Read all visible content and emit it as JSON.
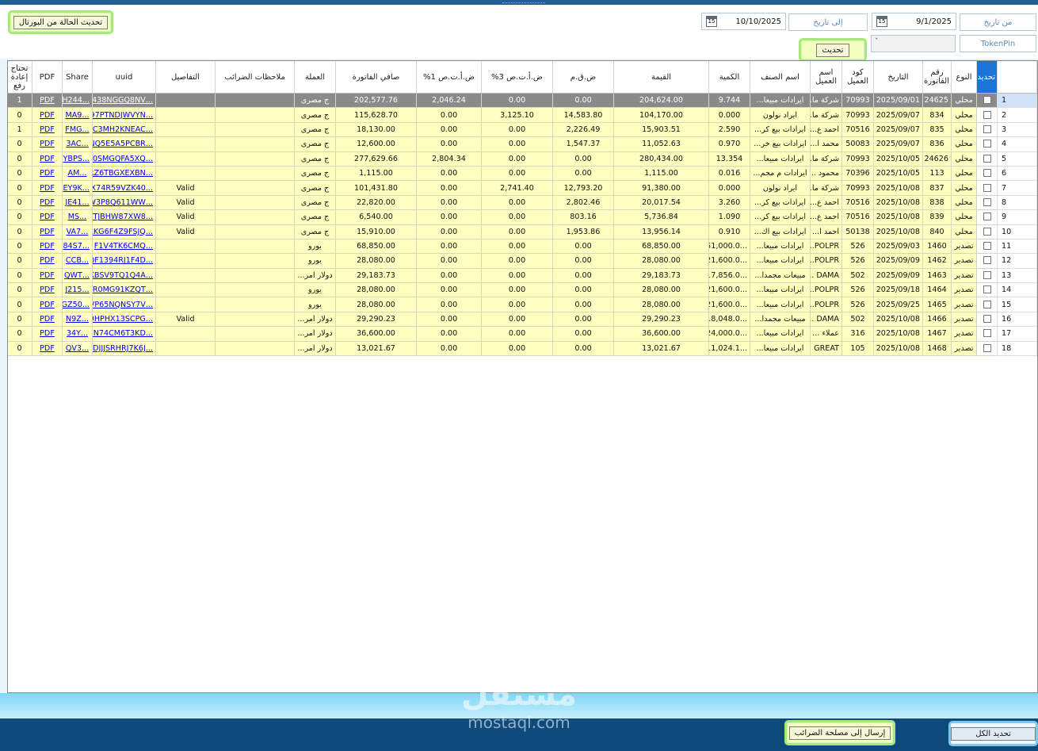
{
  "header": {
    "refresh_status_label": "تحديث الحالة من البورتال",
    "from_date_label": "من تاريخ",
    "from_date_value": "9/1/2025",
    "to_date_label": "إلى تاريخ",
    "to_date_value": "10/10/2025",
    "calendar_glyph": "15",
    "token_label": "TokenPin",
    "combo_chevron": "ˇ",
    "update_label": "تحديث"
  },
  "grid": {
    "columns": [
      "تحديد",
      "النوع",
      "رقم الفاتورة",
      "التاريخ",
      "كود العميل",
      "اسم العميل",
      "اسم الصنف",
      "الكمية",
      "القيمة",
      "ض.ق.م",
      "ض.أ.ت.ص 3%",
      "ض.أ.ت.ص 1%",
      "صافي الفاتورة",
      "العملة",
      "ملاحظات الضرائب",
      "التفاصيل",
      "uuid",
      "Share",
      "PDF",
      "تحتاج إعادة رفع"
    ],
    "pdf_text": "PDF",
    "rows": [
      {
        "n": "1",
        "type": "محلي",
        "inv": "24625",
        "date": "2025/09/01",
        "code": "70993",
        "cust": "شركة ما...",
        "item": "ايرادات مبيعا...",
        "qty": "9.744",
        "value": "204,624.00",
        "vat": "0.00",
        "wht3": "0.00",
        "wht1": "2,046.24",
        "net": "202,577.76",
        "cur": "ج مصرى",
        "notes": "",
        "details": "",
        "uuid": "...P438NGGQ8NV",
        "share": "...H244",
        "reupload": "1"
      },
      {
        "n": "2",
        "type": "محلي",
        "inv": "834",
        "date": "2025/09/07",
        "code": "70993",
        "cust": "شركة ما...",
        "item": "ايراد نولون",
        "qty": "0.000",
        "value": "104,170.00",
        "vat": "14,583.80",
        "wht3": "3,125.10",
        "wht1": "0.00",
        "net": "115,628.70",
        "cur": "ج مصرى",
        "notes": "",
        "details": "",
        "uuid": "...97PTNDJWVYN",
        "share": "...MA9",
        "reupload": "0"
      },
      {
        "n": "3",
        "type": "محلي",
        "inv": "835",
        "date": "2025/09/07",
        "code": "70516",
        "cust": "احمد ع...",
        "item": "ايرادات بيع كر...",
        "qty": "2.590",
        "value": "15,903.51",
        "vat": "2,226.49",
        "wht3": "0.00",
        "wht1": "0.00",
        "net": "18,130.00",
        "cur": "ج مصرى",
        "notes": "",
        "details": "",
        "uuid": "...C3MH2KNEAC",
        "share": "...FMG",
        "reupload": "1"
      },
      {
        "n": "4",
        "type": "محلي",
        "inv": "836",
        "date": "2025/09/07",
        "code": "50083",
        "cust": "محمد ا...",
        "item": "ايرادات بيع خر...",
        "qty": "0.970",
        "value": "11,052.63",
        "vat": "1,547.37",
        "wht3": "0.00",
        "wht1": "0.00",
        "net": "12,600.00",
        "cur": "ج مصرى",
        "notes": "",
        "details": "",
        "uuid": "...NQ5E5A5PCBR",
        "share": "...3AC",
        "reupload": "0"
      },
      {
        "n": "5",
        "type": "محلي",
        "inv": "24626",
        "date": "2025/10/05",
        "code": "70993",
        "cust": "شركة ما...",
        "item": "ايرادات مبيعا...",
        "qty": "13.354",
        "value": "280,434.00",
        "vat": "0.00",
        "wht3": "0.00",
        "wht1": "2,804.34",
        "net": "277,629.66",
        "cur": "ج مصرى",
        "notes": "",
        "details": "",
        "uuid": "...0SMGQFA5XQ",
        "share": "...YBPS",
        "reupload": "0"
      },
      {
        "n": "6",
        "type": "محلي",
        "inv": "113",
        "date": "2025/10/05",
        "code": "70396",
        "cust": "محمود ...",
        "item": "ايرادات م مجم...",
        "qty": "0.016",
        "value": "1,115.00",
        "vat": "0.00",
        "wht3": "0.00",
        "wht1": "0.00",
        "net": "1,115.00",
        "cur": "ج مصرى",
        "notes": "",
        "details": "",
        "uuid": "...RZ6TBGXEXBN",
        "share": "...AM",
        "reupload": "0"
      },
      {
        "n": "7",
        "type": "محلي",
        "inv": "837",
        "date": "2025/10/08",
        "code": "70993",
        "cust": "شركة ما...",
        "item": "ايراد نولون",
        "qty": "0.000",
        "value": "91,380.00",
        "vat": "12,793.20",
        "wht3": "2,741.40",
        "wht1": "0.00",
        "net": "101,431.80",
        "cur": "ج مصرى",
        "notes": "",
        "details": "Valid",
        "uuid": "...5X74R59VZK40",
        "share": "...EY9K",
        "reupload": "0"
      },
      {
        "n": "8",
        "type": "محلي",
        "inv": "838",
        "date": "2025/10/08",
        "code": "70516",
        "cust": "احمد ع...",
        "item": "ايرادات بيع كر...",
        "qty": "3.260",
        "value": "20,017.54",
        "vat": "2,802.46",
        "wht3": "0.00",
        "wht1": "0.00",
        "net": "22,820.00",
        "cur": "ج مصرى",
        "notes": "",
        "details": "Valid",
        "uuid": "...W3P8Q611WW",
        "share": "...JE41",
        "reupload": "0"
      },
      {
        "n": "9",
        "type": "محلي",
        "inv": "839",
        "date": "2025/10/08",
        "code": "70516",
        "cust": "احمد ع...",
        "item": "ايرادات بيع كر...",
        "qty": "1.090",
        "value": "5,736.84",
        "vat": "803.16",
        "wht3": "0.00",
        "wht1": "0.00",
        "net": "6,540.00",
        "cur": "ج مصرى",
        "notes": "",
        "details": "Valid",
        "uuid": "...TTJBHW87XW8",
        "share": "...MS",
        "reupload": "0"
      },
      {
        "n": "10",
        "type": "محلي",
        "inv": "840",
        "date": "2025/10/08",
        "code": "50138",
        "cust": "احمد ا...",
        "item": "ايرادات بيع اك...",
        "qty": "0.910",
        "value": "13,956.14",
        "vat": "1,953.86",
        "wht3": "0.00",
        "wht1": "0.00",
        "net": "15,910.00",
        "cur": "ج مصرى",
        "notes": "",
        "details": "Valid",
        "uuid": "...1RKG6F4Z9FSJQ",
        "share": "...VA7",
        "reupload": "0"
      },
      {
        "n": "11",
        "type": "تصدير",
        "inv": "1460",
        "date": "2025/09/03",
        "code": "526",
        "cust": "POLPR...",
        "item": "ايرادات مبيعا...",
        "qty": "...51,000.0",
        "value": "68,850.00",
        "vat": "0.00",
        "wht3": "0.00",
        "wht1": "0.00",
        "net": "68,850.00",
        "cur": "يورو",
        "notes": "",
        "details": "",
        "uuid": "...F1V4TK6CMQ",
        "share": "...84S7",
        "reupload": "0"
      },
      {
        "n": "12",
        "type": "تصدير",
        "inv": "1462",
        "date": "2025/09/09",
        "code": "526",
        "cust": "POLPR...",
        "item": "ايرادات مبيعا...",
        "qty": "...21,600.0",
        "value": "28,080.00",
        "vat": "0.00",
        "wht3": "0.00",
        "wht1": "0.00",
        "net": "28,080.00",
        "cur": "يورو",
        "notes": "",
        "details": "",
        "uuid": "...0QF1394RJ1F4D",
        "share": "...CCB",
        "reupload": "0"
      },
      {
        "n": "13",
        "type": "تصدير",
        "inv": "1463",
        "date": "2025/09/09",
        "code": "502",
        "cust": "DAMA ...",
        "item": "مبيعات مجمدا...",
        "qty": "...17,856.0",
        "value": "29,183.73",
        "vat": "0.00",
        "wht3": "0.00",
        "wht1": "0.00",
        "net": "29,183.73",
        "cur": "دولار امر...",
        "notes": "",
        "details": "",
        "uuid": "...KBSV9TQ1Q4A",
        "share": "...QWT",
        "reupload": "0"
      },
      {
        "n": "14",
        "type": "تصدير",
        "inv": "1464",
        "date": "2025/09/18",
        "code": "526",
        "cust": "POLPR...",
        "item": "ايرادات مبيعا...",
        "qty": "...21,600.0",
        "value": "28,080.00",
        "vat": "0.00",
        "wht3": "0.00",
        "wht1": "0.00",
        "net": "28,080.00",
        "cur": "يورو",
        "notes": "",
        "details": "",
        "uuid": "...9R0MG91KZQT",
        "share": "...J215",
        "reupload": "0"
      },
      {
        "n": "15",
        "type": "تصدير",
        "inv": "1465",
        "date": "2025/09/25",
        "code": "526",
        "cust": "POLPR...",
        "item": "ايرادات مبيعا...",
        "qty": "...21,600.0",
        "value": "28,080.00",
        "vat": "0.00",
        "wht3": "0.00",
        "wht1": "0.00",
        "net": "28,080.00",
        "cur": "يورو",
        "notes": "",
        "details": "",
        "uuid": "...VP65NQNSY7V",
        "share": "...GZ50",
        "reupload": "0"
      },
      {
        "n": "16",
        "type": "تصدير",
        "inv": "1466",
        "date": "2025/10/08",
        "code": "502",
        "cust": "DAMA ...",
        "item": "مبيعات مجمدا...",
        "qty": "...18,048.0",
        "value": "29,290.23",
        "vat": "0.00",
        "wht3": "0.00",
        "wht1": "0.00",
        "net": "29,290.23",
        "cur": "دولار امر...",
        "notes": "",
        "details": "Valid",
        "uuid": "...9HPHX13SCPG",
        "share": "...N9Z",
        "reupload": "0"
      },
      {
        "n": "17",
        "type": "تصدير",
        "inv": "1467",
        "date": "2025/10/08",
        "code": "316",
        "cust": "عملاء ...",
        "item": "ايرادات مبيعا...",
        "qty": "...24,000.0",
        "value": "36,600.00",
        "vat": "0.00",
        "wht3": "0.00",
        "wht1": "0.00",
        "net": "36,600.00",
        "cur": "دولار امر...",
        "notes": "",
        "details": "",
        "uuid": "...5N74CM6T3KD",
        "share": "...34Y",
        "reupload": "0"
      },
      {
        "n": "18",
        "type": "تصدير",
        "inv": "1468",
        "date": "2025/10/08",
        "code": "105",
        "cust": "GREAT ...",
        "item": "ايرادات مبيعا...",
        "qty": "...11,024.1",
        "value": "13,021.67",
        "vat": "0.00",
        "wht3": "0.00",
        "wht1": "0.00",
        "net": "13,021.67",
        "cur": "دولار امر...",
        "notes": "",
        "details": "",
        "uuid": "...DJJJSRHRJ7K6J",
        "share": "...QV3",
        "reupload": "0"
      }
    ]
  },
  "footer": {
    "send_label": "إرسال إلى مصلحة الضرائب",
    "select_all_label": "تحديد الكل",
    "watermark_ar": "مستقل",
    "watermark_en": "mostaql.com"
  },
  "colors": {
    "grid_row": "#ffffc0",
    "selected_row": "#8a8a8a",
    "accent_header": "#1e73d8",
    "footer": "#0e4a7c"
  }
}
